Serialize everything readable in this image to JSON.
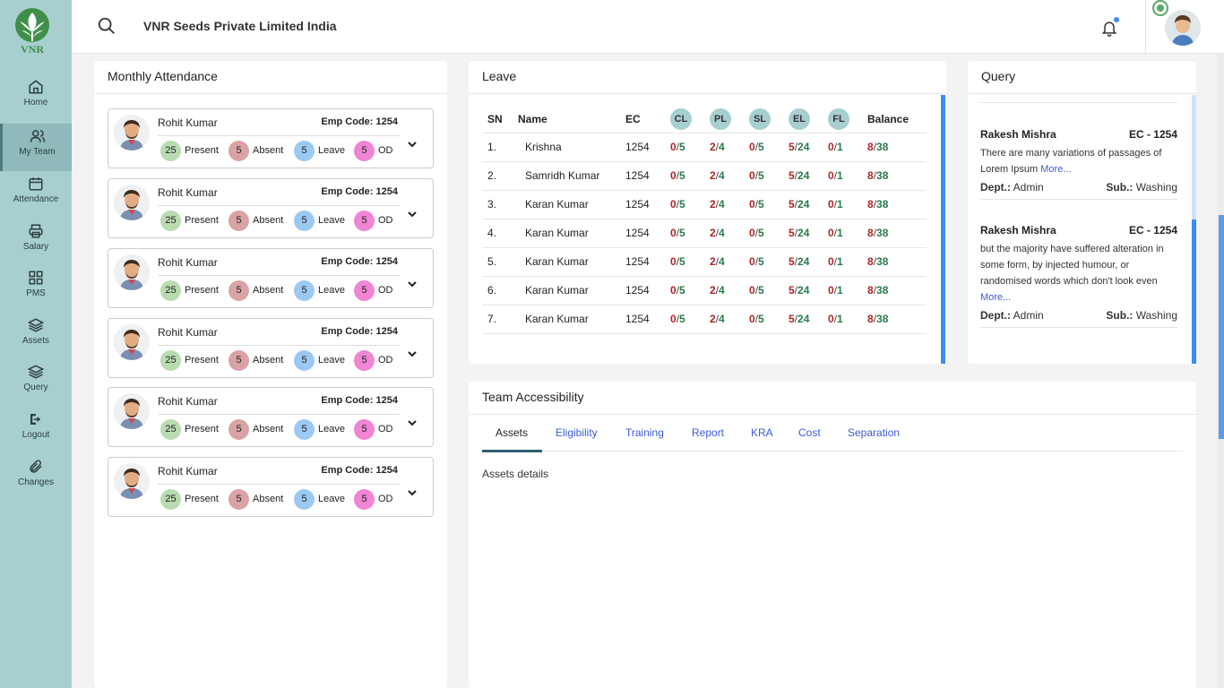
{
  "app": {
    "logo_text": "VNR",
    "company": "VNR Seeds Private Limited India"
  },
  "sidebar": {
    "items": [
      {
        "label": "Home",
        "icon": "home-icon",
        "active": false
      },
      {
        "label": "My Team",
        "icon": "team-icon",
        "active": true
      },
      {
        "label": "Attendance",
        "icon": "calendar-icon",
        "active": false
      },
      {
        "label": "Salary",
        "icon": "printer-icon",
        "active": false
      },
      {
        "label": "PMS",
        "icon": "grid-icon",
        "active": false
      },
      {
        "label": "Assets",
        "icon": "layers-icon",
        "active": false
      },
      {
        "label": "Query",
        "icon": "layers-icon",
        "active": false
      },
      {
        "label": "Logout",
        "icon": "logout-icon",
        "active": false
      },
      {
        "label": "Changes",
        "icon": "paperclip-icon",
        "active": false
      }
    ]
  },
  "attendance": {
    "title": "Monthly Attendance",
    "cards": [
      {
        "name": "Rohit Kumar",
        "code": "Emp Code: 1254",
        "present": "25",
        "present_label": "Present",
        "absent": "5",
        "absent_label": "Absent",
        "leave": "5",
        "leave_label": "Leave",
        "od": "5",
        "od_label": "OD"
      },
      {
        "name": "Rohit Kumar",
        "code": "Emp Code: 1254",
        "present": "25",
        "present_label": "Present",
        "absent": "5",
        "absent_label": "Absent",
        "leave": "5",
        "leave_label": "Leave",
        "od": "5",
        "od_label": "OD"
      },
      {
        "name": "Rohit Kumar",
        "code": "Emp Code: 1254",
        "present": "25",
        "present_label": "Present",
        "absent": "5",
        "absent_label": "Absent",
        "leave": "5",
        "leave_label": "Leave",
        "od": "5",
        "od_label": "OD"
      },
      {
        "name": "Rohit Kumar",
        "code": "Emp Code: 1254",
        "present": "25",
        "present_label": "Present",
        "absent": "5",
        "absent_label": "Absent",
        "leave": "5",
        "leave_label": "Leave",
        "od": "5",
        "od_label": "OD"
      },
      {
        "name": "Rohit Kumar",
        "code": "Emp Code: 1254",
        "present": "25",
        "present_label": "Present",
        "absent": "5",
        "absent_label": "Absent",
        "leave": "5",
        "leave_label": "Leave",
        "od": "5",
        "od_label": "OD"
      },
      {
        "name": "Rohit Kumar",
        "code": "Emp Code: 1254",
        "present": "25",
        "present_label": "Present",
        "absent": "5",
        "absent_label": "Absent",
        "leave": "5",
        "leave_label": "Leave",
        "od": "5",
        "od_label": "OD"
      }
    ],
    "colors": {
      "present": "#b9dbb0",
      "absent": "#d9a3a6",
      "leave": "#9cc9f2",
      "od": "#ef85d3"
    }
  },
  "leave": {
    "title": "Leave",
    "headers": {
      "sn": "SN",
      "name": "Name",
      "ec": "EC",
      "cl": "CL",
      "pl": "PL",
      "sl": "SL",
      "el": "EL",
      "fl": "FL",
      "balance": "Balance"
    },
    "rows": [
      {
        "sn": "1.",
        "name": "Krishna",
        "ec": "1254",
        "cl_u": "0",
        "cl_t": "5",
        "pl_u": "2",
        "pl_t": "4",
        "sl_u": "0",
        "sl_t": "5",
        "el_u": "5",
        "el_t": "24",
        "fl_u": "0",
        "fl_t": "1",
        "bal_u": "8",
        "bal_t": "38"
      },
      {
        "sn": "2.",
        "name": "Samridh Kumar",
        "ec": "1254",
        "cl_u": "0",
        "cl_t": "5",
        "pl_u": "2",
        "pl_t": "4",
        "sl_u": "0",
        "sl_t": "5",
        "el_u": "5",
        "el_t": "24",
        "fl_u": "0",
        "fl_t": "1",
        "bal_u": "8",
        "bal_t": "38"
      },
      {
        "sn": "3.",
        "name": "Karan Kumar",
        "ec": "1254",
        "cl_u": "0",
        "cl_t": "5",
        "pl_u": "2",
        "pl_t": "4",
        "sl_u": "0",
        "sl_t": "5",
        "el_u": "5",
        "el_t": "24",
        "fl_u": "0",
        "fl_t": "1",
        "bal_u": "8",
        "bal_t": "38"
      },
      {
        "sn": "4.",
        "name": "Karan Kumar",
        "ec": "1254",
        "cl_u": "0",
        "cl_t": "5",
        "pl_u": "2",
        "pl_t": "4",
        "sl_u": "0",
        "sl_t": "5",
        "el_u": "5",
        "el_t": "24",
        "fl_u": "0",
        "fl_t": "1",
        "bal_u": "8",
        "bal_t": "38"
      },
      {
        "sn": "5.",
        "name": "Karan Kumar",
        "ec": "1254",
        "cl_u": "0",
        "cl_t": "5",
        "pl_u": "2",
        "pl_t": "4",
        "sl_u": "0",
        "sl_t": "5",
        "el_u": "5",
        "el_t": "24",
        "fl_u": "0",
        "fl_t": "1",
        "bal_u": "8",
        "bal_t": "38"
      },
      {
        "sn": "6.",
        "name": "Karan Kumar",
        "ec": "1254",
        "cl_u": "0",
        "cl_t": "5",
        "pl_u": "2",
        "pl_t": "4",
        "sl_u": "0",
        "sl_t": "5",
        "el_u": "5",
        "el_t": "24",
        "fl_u": "0",
        "fl_t": "1",
        "bal_u": "8",
        "bal_t": "38"
      },
      {
        "sn": "7.",
        "name": "Karan Kumar",
        "ec": "1254",
        "cl_u": "0",
        "cl_t": "5",
        "pl_u": "2",
        "pl_t": "4",
        "sl_u": "0",
        "sl_t": "5",
        "el_u": "5",
        "el_t": "24",
        "fl_u": "0",
        "fl_t": "1",
        "bal_u": "8",
        "bal_t": "38"
      }
    ]
  },
  "query": {
    "title": "Query",
    "items": [
      {
        "name": "Rakesh Mishra",
        "ec": "EC - 1254",
        "text": "There are many variations of passages of Lorem Ipsum",
        "more": "More...",
        "dept_label": "Dept.:",
        "dept": "Admin",
        "sub_label": "Sub.:",
        "sub": "Washing"
      },
      {
        "name": "Rakesh Mishra",
        "ec": "EC - 1254",
        "text": "but the majority have suffered alteration in some form, by injected humour, or randomised words which don't look even",
        "more": "More...",
        "dept_label": "Dept.:",
        "dept": "Admin",
        "sub_label": "Sub.:",
        "sub": "Washing"
      }
    ]
  },
  "team": {
    "title": "Team Accessibility",
    "tabs": [
      "Assets",
      "Eligibility",
      "Training",
      "Report",
      "KRA",
      "Cost",
      "Separation"
    ],
    "active_tab": "Assets",
    "content": "Assets details"
  }
}
